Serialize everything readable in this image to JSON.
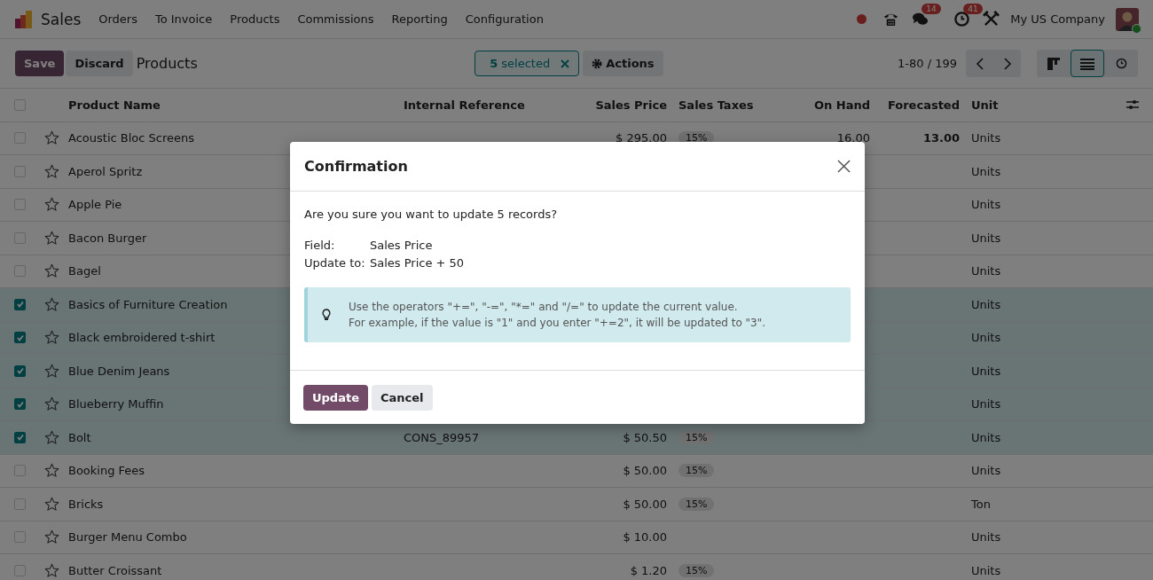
{
  "navbar": {
    "app": "Sales",
    "menu": [
      "Orders",
      "To Invoice",
      "Products",
      "Commissions",
      "Reporting",
      "Configuration"
    ],
    "chat_count": "14",
    "activity_count": "41",
    "company": "My US Company"
  },
  "control_panel": {
    "save": "Save",
    "discard": "Discard",
    "title": "Products",
    "selection": "**5** selected",
    "actions": "Actions",
    "pager": "1-80 / 199",
    "views": [
      {
        "kind": "kanban",
        "selected": false
      },
      {
        "kind": "list",
        "selected": true
      },
      {
        "kind": "activity",
        "selected": false
      }
    ]
  },
  "table": {
    "select_all_checked": false,
    "columns": [
      "Product Name",
      "Internal Reference",
      "Sales Price",
      "Sales Taxes",
      "On Hand",
      "Forecasted",
      "Unit"
    ],
    "rows": [
      {
        "name": "Acoustic Bloc Screens",
        "price": "$ 295.00",
        "taxes": "15%",
        "on_hand": "16.00",
        "forecasted": "13.00",
        "unit": "Units",
        "selected": false
      },
      {
        "name": "Aperol Spritz",
        "unit": "Units",
        "selected": false
      },
      {
        "name": "Apple Pie",
        "unit": "Units",
        "selected": false
      },
      {
        "name": "Bacon Burger",
        "unit": "Units",
        "selected": false
      },
      {
        "name": "Bagel",
        "unit": "Units",
        "selected": false
      },
      {
        "name": "Basics of Furniture Creation",
        "unit": "Units",
        "selected": true
      },
      {
        "name": "Black embroidered t-shirt",
        "unit": "Units",
        "selected": true
      },
      {
        "name": "Blue Denim Jeans",
        "unit": "Units",
        "selected": true
      },
      {
        "name": "Blueberry Muffin",
        "unit": "Units",
        "selected": true
      },
      {
        "name": "Bolt",
        "ref": "CONS_89957",
        "price": "$ 50.50",
        "taxes": "15%",
        "unit": "Units",
        "selected": true
      },
      {
        "name": "Booking Fees",
        "price": "$ 50.00",
        "taxes": "15%",
        "unit": "Units",
        "selected": false
      },
      {
        "name": "Bricks",
        "price": "$ 50.00",
        "taxes": "15%",
        "unit": "Ton",
        "selected": false
      },
      {
        "name": "Burger Menu Combo",
        "price": "$ 10.00",
        "unit": "Units",
        "selected": false
      },
      {
        "name": "Butter Croissant",
        "price": "$ 1.20",
        "taxes": "15%",
        "unit": "Units",
        "selected": false
      }
    ]
  },
  "dialog": {
    "title": "Confirmation",
    "message": "Are you sure you want to update 5 records?",
    "fields": [
      {
        "label": "Field:",
        "value": "Sales Price"
      },
      {
        "label": "Update to:",
        "value": "Sales Price + 50"
      }
    ],
    "tip": [
      "Use the operators \"+=\", \"-=\", \"*=\" and \"/=\" to update the current value.",
      "For example, if the value is \"1\" and you enter \"+=2\", it will be updated to \"3\"."
    ],
    "update": "Update",
    "cancel": "Cancel"
  }
}
